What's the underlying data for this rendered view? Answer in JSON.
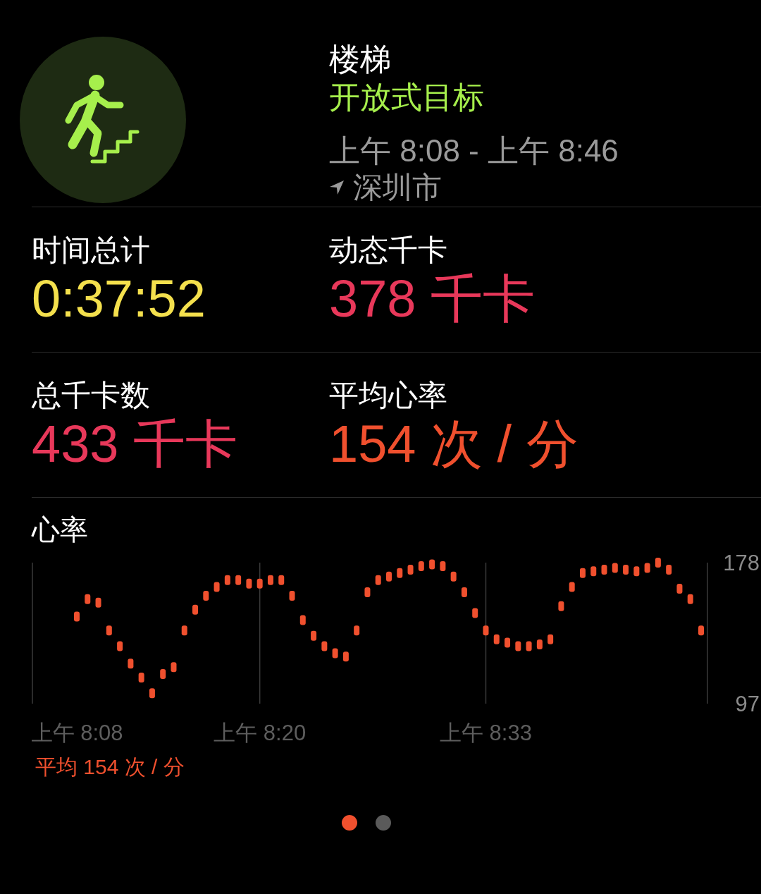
{
  "workout": {
    "title": "楼梯",
    "goal": "开放式目标",
    "time_range": "上午 8:08 - 上午 8:46",
    "location": "深圳市"
  },
  "metrics": [
    {
      "label": "时间总计",
      "value": "0:37:52",
      "color": "#f4e04d"
    },
    {
      "label": "动态千卡",
      "value": "378 千卡",
      "color": "#e8385a"
    },
    {
      "label": "总千卡数",
      "value": "433 千卡",
      "color": "#e8385a"
    },
    {
      "label": "平均心率",
      "value": "154 次 / 分",
      "color": "#f0502e"
    }
  ],
  "heart_rate": {
    "average": "平均 154 次 / 分",
    "chart_data": {
      "type": "scatter",
      "ylim": [
        97,
        178
      ],
      "yticks": [
        97,
        178
      ],
      "categories": [
        "上午 8:08",
        null,
        null,
        null,
        null,
        null,
        null,
        null,
        null,
        null,
        null,
        null,
        null,
        null,
        null,
        null,
        null,
        "上午 8:20",
        null,
        null,
        null,
        null,
        null,
        null,
        null,
        null,
        null,
        null,
        null,
        null,
        null,
        null,
        null,
        null,
        null,
        null,
        null,
        null,
        "上午 8:33",
        null,
        null,
        null,
        null,
        null,
        null,
        null,
        null,
        null,
        null,
        null,
        null,
        null,
        null,
        null,
        null,
        null,
        null,
        null,
        null
      ],
      "series": [
        {
          "name": "心率",
          "color": "#f0502e",
          "values": [
            147,
            157,
            155,
            139,
            130,
            120,
            112,
            103,
            114,
            118,
            139,
            151,
            159,
            164,
            168,
            168,
            166,
            166,
            168,
            168,
            159,
            145,
            136,
            130,
            126,
            124,
            139,
            161,
            168,
            170,
            172,
            174,
            176,
            177,
            176,
            170,
            161,
            149,
            139,
            134,
            132,
            130,
            130,
            131,
            134,
            153,
            164,
            172,
            173,
            174,
            175,
            174,
            173,
            175,
            178,
            174,
            163,
            157,
            139
          ]
        }
      ]
    }
  },
  "pager": [
    {
      "selected": true
    },
    {
      "selected": false
    }
  ]
}
